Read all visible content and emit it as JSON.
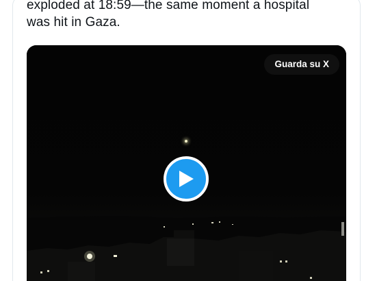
{
  "tweet": {
    "text_lines": [
      "exploded at 18:59—the same moment a hospital",
      "was hit in Gaza."
    ]
  },
  "video": {
    "watch_on_x_label": "Guarda su X",
    "play_icon": "play-icon",
    "colors": {
      "play_button": "#1d9bf0",
      "background": "#030303"
    }
  }
}
